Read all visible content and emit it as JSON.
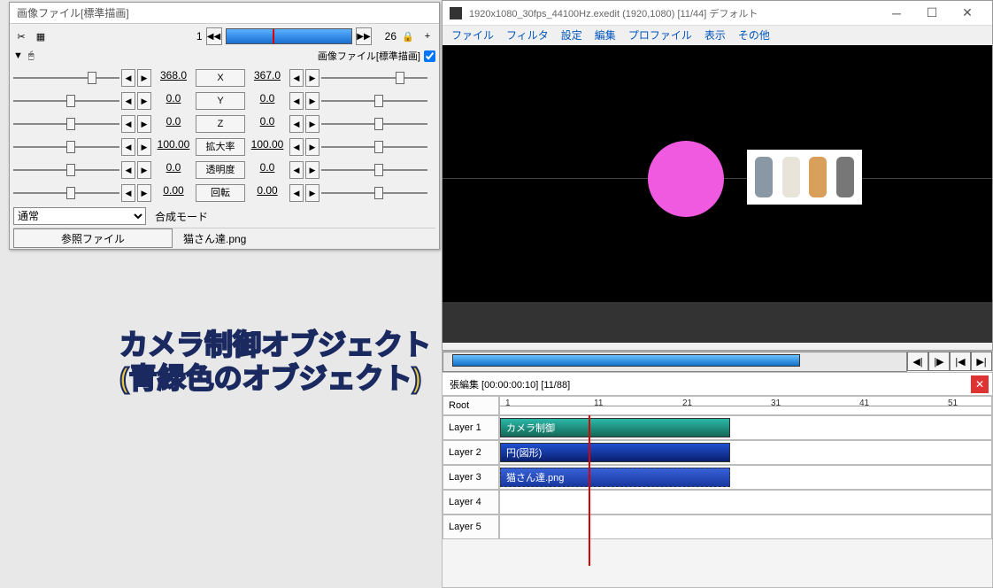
{
  "prop_panel": {
    "title": "画像ファイル[標準描画]",
    "frame_current": "1",
    "frame_total": "26",
    "checkbox_label": "画像ファイル[標準描画]",
    "params": [
      {
        "label": "X",
        "left": "368.0",
        "right": "367.0"
      },
      {
        "label": "Y",
        "left": "0.0",
        "right": "0.0"
      },
      {
        "label": "Z",
        "left": "0.0",
        "right": "0.0"
      },
      {
        "label": "拡大率",
        "left": "100.00",
        "right": "100.00"
      },
      {
        "label": "透明度",
        "left": "0.0",
        "right": "0.0"
      },
      {
        "label": "回転",
        "left": "0.00",
        "right": "0.00"
      }
    ],
    "mode_label": "合成モード",
    "mode_value": "通常",
    "ref_button": "参照ファイル",
    "file_name": "猫さん達.png"
  },
  "preview": {
    "title": "1920x1080_30fps_44100Hz.exedit (1920,1080) [11/44] デフォルト",
    "menu": [
      "ファイル",
      "フィルタ",
      "設定",
      "編集",
      "プロファイル",
      "表示",
      "その他"
    ]
  },
  "annotation": {
    "line1": "カメラ制御オブジェクト",
    "line2": "(青緑色のオブジェクト)"
  },
  "timeline": {
    "header_info": "張編集 [00:00:00:10] [11/88]",
    "root_label": "Root",
    "ticks": [
      "1",
      "11",
      "21",
      "31",
      "41",
      "51"
    ],
    "layers": [
      "Layer 1",
      "Layer 2",
      "Layer 3",
      "Layer 4",
      "Layer 5"
    ],
    "objects": {
      "camera": "カメラ制御",
      "circle": "円(図形)",
      "image": "猫さん達.png"
    }
  }
}
